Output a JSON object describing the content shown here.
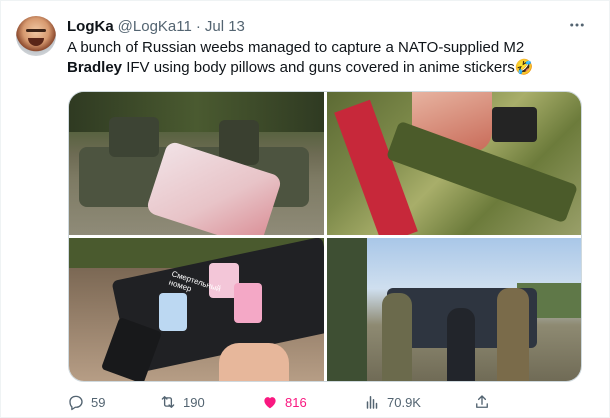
{
  "tweet": {
    "author_name": "LogKa",
    "author_handle": "@LogKa11",
    "separator": "·",
    "date": "Jul 13",
    "text_line1": "A bunch of Russian weebs managed to capture a NATO-supplied M2",
    "text_bold": "Bradley",
    "text_line2_rest": " IFV using body pillows and guns covered in anime stickers",
    "emoji": "🤣",
    "more_icon": "more-icon"
  },
  "media": {
    "photos": [
      {
        "name": "tank-with-anime-body-pillow-photo"
      },
      {
        "name": "rifle-with-anime-sling-photo"
      },
      {
        "name": "rifle-with-anime-stickers-photo"
      },
      {
        "name": "soldiers-group-photo"
      }
    ],
    "sticker_text": "Смертельный номер"
  },
  "actions": {
    "replies": "59",
    "retweets": "190",
    "likes": "816",
    "views": "70.9K",
    "like_color": "#f91880",
    "icon_color": "#536471"
  }
}
